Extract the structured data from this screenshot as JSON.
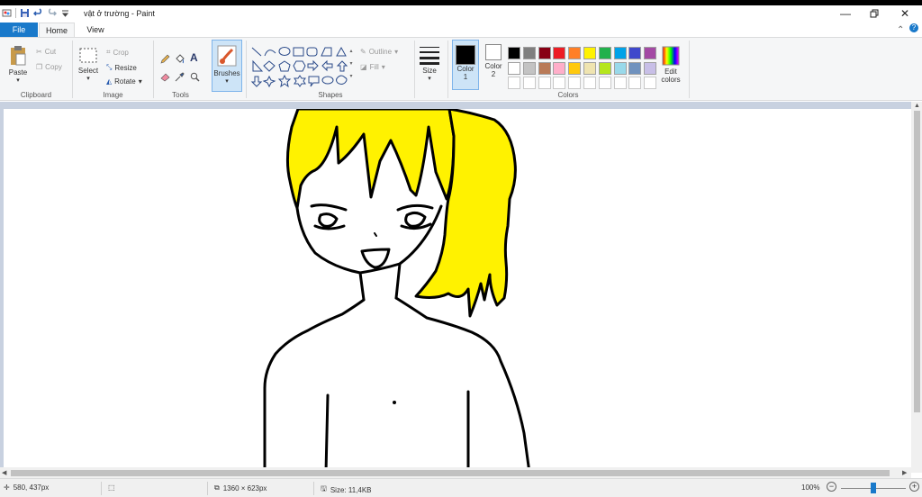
{
  "window": {
    "title": "vật ở trường - Paint",
    "controls": [
      "minimize",
      "restore",
      "close"
    ]
  },
  "tabs": {
    "file": "File",
    "home": "Home",
    "view": "View"
  },
  "ribbon": {
    "clipboard": {
      "label": "Clipboard",
      "paste": "Paste",
      "cut": "Cut",
      "copy": "Copy"
    },
    "image": {
      "label": "Image",
      "select": "Select",
      "crop": "Crop",
      "resize": "Resize",
      "rotate": "Rotate"
    },
    "tools": {
      "label": "Tools"
    },
    "brushes": {
      "label": "Brushes"
    },
    "shapes": {
      "label": "Shapes",
      "outline": "Outline",
      "fill": "Fill"
    },
    "size": {
      "label": "Size"
    },
    "colors": {
      "label": "Colors",
      "color1": "Color",
      "color1_num": "1",
      "color2": "Color",
      "color2_num": "2",
      "edit": "Edit",
      "edit2": "colors",
      "color1_value": "#000000",
      "color2_value": "#ffffff",
      "palette_row1": [
        "#000000",
        "#7f7f7f",
        "#880015",
        "#ed1c24",
        "#ff7f27",
        "#fff200",
        "#22b14c",
        "#00a2e8",
        "#3f48cc",
        "#a349a4"
      ],
      "palette_row2": [
        "#ffffff",
        "#c3c3c3",
        "#b97a57",
        "#ffaec9",
        "#ffc90e",
        "#efe4b0",
        "#b5e61d",
        "#99d9ea",
        "#7092be",
        "#c8bfe7"
      ],
      "palette_row3_count": 10
    }
  },
  "canvas": {
    "drawing_colors": {
      "hair": "#fff200",
      "line": "#000000"
    }
  },
  "status": {
    "cursor_pos": "580, 437px",
    "image_size": "1360 × 623px",
    "file_size": "Size: 11,4KB",
    "zoom": "100%",
    "zoom_minus": "−",
    "zoom_plus": "+",
    "zoom_level": 0.5
  }
}
